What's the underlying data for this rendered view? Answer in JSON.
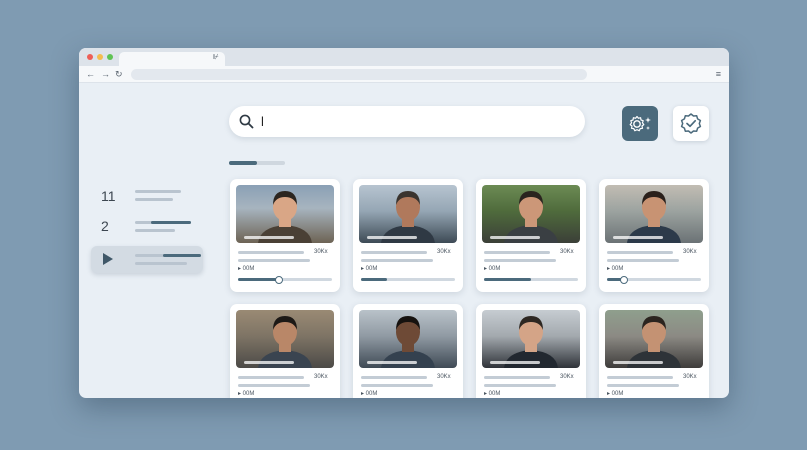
{
  "browser": {
    "tab_icon": "⊮",
    "nav_back": "←",
    "nav_forward": "→",
    "nav_reload": "↻",
    "menu": "≡"
  },
  "search": {
    "value": "l",
    "icon": "search-icon"
  },
  "actions": {
    "settings_icon": "gear-sparkle-icon",
    "verify_icon": "verified-badge-icon"
  },
  "sidebar": {
    "items": [
      {
        "label": "11"
      },
      {
        "label": "2"
      },
      {
        "label": "",
        "icon": "play-icon"
      }
    ]
  },
  "videos": [
    {
      "meta": "30Kx",
      "views": "▸ 00M",
      "progress": 0.44,
      "knob": true,
      "bg": "linear-gradient(180deg,#8aa0b5 0%,#a7b4bf 40%,#6d6354 100%)"
    },
    {
      "meta": "30Kx",
      "views": "▸ 00M",
      "progress": 0.28,
      "knob": false,
      "bg": "linear-gradient(180deg,#b7c4d0 0%,#95a6b4 45%,#3d4a55 100%)"
    },
    {
      "meta": "30Kx",
      "views": "▸ 00M",
      "progress": 0.5,
      "knob": false,
      "bg": "linear-gradient(180deg,#6c8b54 0%,#4f6b3c 45%,#3b3f38 100%)"
    },
    {
      "meta": "30Kx",
      "views": "▸ 00M",
      "progress": 0.18,
      "knob": true,
      "bg": "linear-gradient(180deg,#c2bdb3 0%,#9ca3a0 45%,#6b7275 100%)"
    },
    {
      "meta": "30Kx",
      "views": "▸ 00M",
      "progress": 0.0,
      "knob": false,
      "bg": "linear-gradient(180deg,#9a8a74 0%,#7e7465 45%,#4c4a47 100%)"
    },
    {
      "meta": "30Kx",
      "views": "▸ 00M",
      "progress": 0.0,
      "knob": false,
      "bg": "linear-gradient(180deg,#b9c2c9 0%,#909aa3 45%,#3f4a55 100%)"
    },
    {
      "meta": "30Kx",
      "views": "▸ 00M",
      "progress": 0.0,
      "knob": false,
      "bg": "linear-gradient(180deg,#c6ccd1 0%,#a3a9ae 45%,#2f3339 100%)"
    },
    {
      "meta": "30Kx",
      "views": "▸ 00M",
      "progress": 0.0,
      "knob": false,
      "bg": "linear-gradient(180deg,#8f9f8d 0%,#8c8a84 45%,#3e3c3b 100%)"
    }
  ],
  "colors": {
    "accent": "#4b6a7c",
    "background": "#7f9bb2",
    "window": "#e9eff5"
  }
}
